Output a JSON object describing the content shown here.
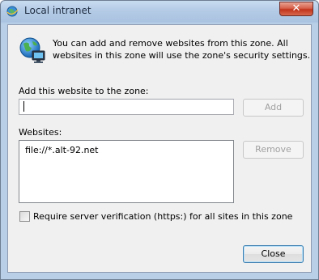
{
  "window": {
    "title": "Local intranet",
    "close_glyph": "✕"
  },
  "info": {
    "icon": "globe-network-icon",
    "text": "You can add and remove websites from this zone. All websites in this zone will use the zone's security settings."
  },
  "add_site": {
    "label": "Add this website to the zone:",
    "value": "",
    "placeholder": "",
    "add_button": "Add",
    "add_enabled": false
  },
  "websites": {
    "label": "Websites:",
    "items": [
      "file://*.alt-92.net"
    ],
    "remove_button": "Remove",
    "remove_enabled": false
  },
  "verification": {
    "label": "Require server verification (https:) for all sites in this zone",
    "checked": false
  },
  "footer": {
    "close_button": "Close"
  },
  "colors": {
    "accent": "#3c7fb1",
    "close_red": "#c2341c"
  }
}
